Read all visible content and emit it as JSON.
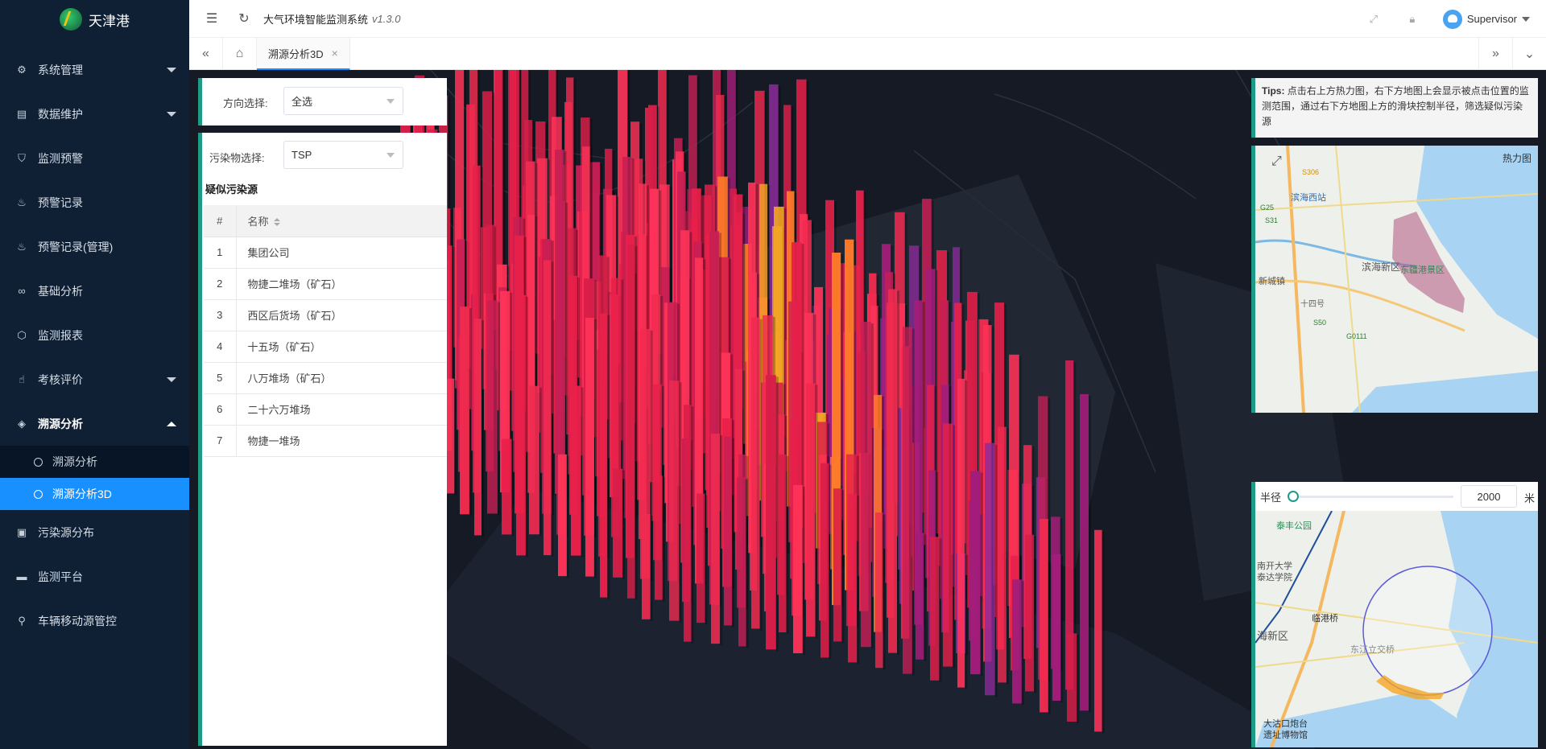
{
  "app": {
    "name": "天津港",
    "title": "大气环境智能监测系统",
    "version": "v1.3.0",
    "user": "Supervisor"
  },
  "sidebar": {
    "items": [
      {
        "label": "系统管理",
        "icon": "gear-icon",
        "arrow": "down"
      },
      {
        "label": "数据维护",
        "icon": "database-icon",
        "arrow": "down"
      },
      {
        "label": "监测预警",
        "icon": "shield-icon"
      },
      {
        "label": "预警记录",
        "icon": "flame-icon"
      },
      {
        "label": "预警记录(管理)",
        "icon": "flame-icon"
      },
      {
        "label": "基础分析",
        "icon": "infinity-icon"
      },
      {
        "label": "监测报表",
        "icon": "cube-icon"
      },
      {
        "label": "考核评价",
        "icon": "thumbs-up-icon",
        "arrow": "down"
      },
      {
        "label": "溯源分析",
        "icon": "layers-icon",
        "arrow": "up",
        "open": true
      }
    ],
    "sub_items": [
      {
        "label": "溯源分析"
      },
      {
        "label": "溯源分析3D",
        "active": true
      }
    ],
    "items_after": [
      {
        "label": "污染源分布",
        "icon": "image-icon"
      },
      {
        "label": "监测平台",
        "icon": "monitor-icon"
      },
      {
        "label": "车辆移动源管控",
        "icon": "location-pin-icon"
      }
    ]
  },
  "tabs": {
    "active_label": "溯源分析3D"
  },
  "filters": {
    "direction_label": "方向选择:",
    "direction_value": "全选",
    "pollutant_label": "污染物选择:",
    "pollutant_value": "TSP"
  },
  "suspect": {
    "title": "疑似污染源",
    "headers": [
      "#",
      "名称"
    ],
    "rows": [
      {
        "idx": "1",
        "name": "集团公司"
      },
      {
        "idx": "2",
        "name": "物捷二堆场（矿石）"
      },
      {
        "idx": "3",
        "name": "西区后货场（矿石）"
      },
      {
        "idx": "4",
        "name": "十五场（矿石）"
      },
      {
        "idx": "5",
        "name": "八万堆场（矿石）"
      },
      {
        "idx": "6",
        "name": "二十六万堆场"
      },
      {
        "idx": "7",
        "name": "物捷一堆场"
      }
    ]
  },
  "tips": {
    "prefix": "Tips:",
    "text": "点击右上方热力图，右下方地图上会显示被点击位置的监测范围，通过右下方地图上方的滑块控制半径，筛选疑似污染源"
  },
  "heatmap": {
    "label": "热力图",
    "places": [
      "滨海西站",
      "滨海新区",
      "东疆港景区",
      "新城镇",
      "十四号",
      "G25",
      "S31",
      "S50",
      "G0111",
      "S306"
    ]
  },
  "radius": {
    "label": "半径",
    "value": "2000",
    "unit": "米",
    "level": 0.0
  },
  "detail_map": {
    "places": [
      "泰丰公园",
      "南开大学泰达学院",
      "临港桥",
      "海新区",
      "东江立交桥",
      "大沽口炮台遗址博物馆"
    ]
  },
  "colors": {
    "accent": "#1890ff",
    "panel_border": "#1e9b87",
    "sidebar_bg": "#0f2035",
    "map_bg": "#161a24"
  }
}
